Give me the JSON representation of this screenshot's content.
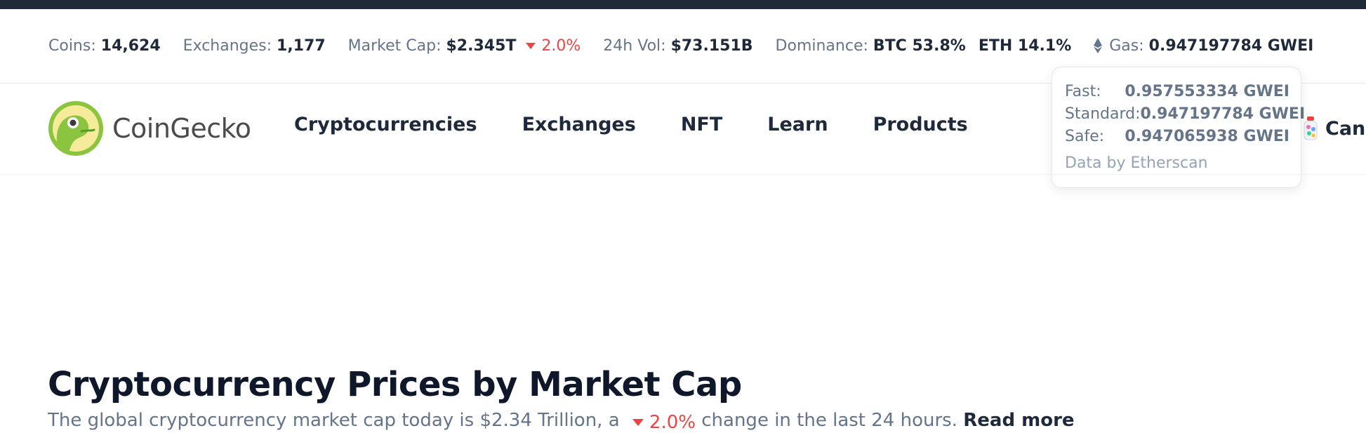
{
  "stats": {
    "coins_label": "Coins:",
    "coins_value": "14,624",
    "exchanges_label": "Exchanges:",
    "exchanges_value": "1,177",
    "market_cap_label": "Market Cap:",
    "market_cap_value": "$2.345T",
    "market_cap_change": "2.0%",
    "volume_label": "24h Vol:",
    "volume_value": "$73.151B",
    "dominance_label": "Dominance:",
    "dominance_btc": "BTC 53.8%",
    "dominance_eth": "ETH 14.1%",
    "gas_label": "Gas:",
    "gas_value": "0.947197784 GWEI"
  },
  "logo": {
    "text": "CoinGecko"
  },
  "nav": {
    "items": [
      "Cryptocurrencies",
      "Exchanges",
      "NFT",
      "Learn",
      "Products"
    ]
  },
  "candy": {
    "label": "Canc"
  },
  "gas_tooltip": {
    "fast_label": "Fast:",
    "fast_value": "0.957553334 GWEI",
    "standard_label": "Standard:",
    "standard_value": "0.947197784 GWEI",
    "safe_label": "Safe:",
    "safe_value": "0.947065938 GWEI",
    "footer": "Data by Etherscan"
  },
  "main": {
    "title": "Cryptocurrency Prices by Market Cap",
    "desc_prefix": "The global cryptocurrency market cap today is $2.34 Trillion, a",
    "desc_change": "2.0%",
    "desc_suffix": "change in the last 24 hours.",
    "read_more": "Read more"
  },
  "colors": {
    "accent_negative": "#ef4444",
    "topbar": "#1f2937",
    "logo_green": "#8bc53f"
  }
}
